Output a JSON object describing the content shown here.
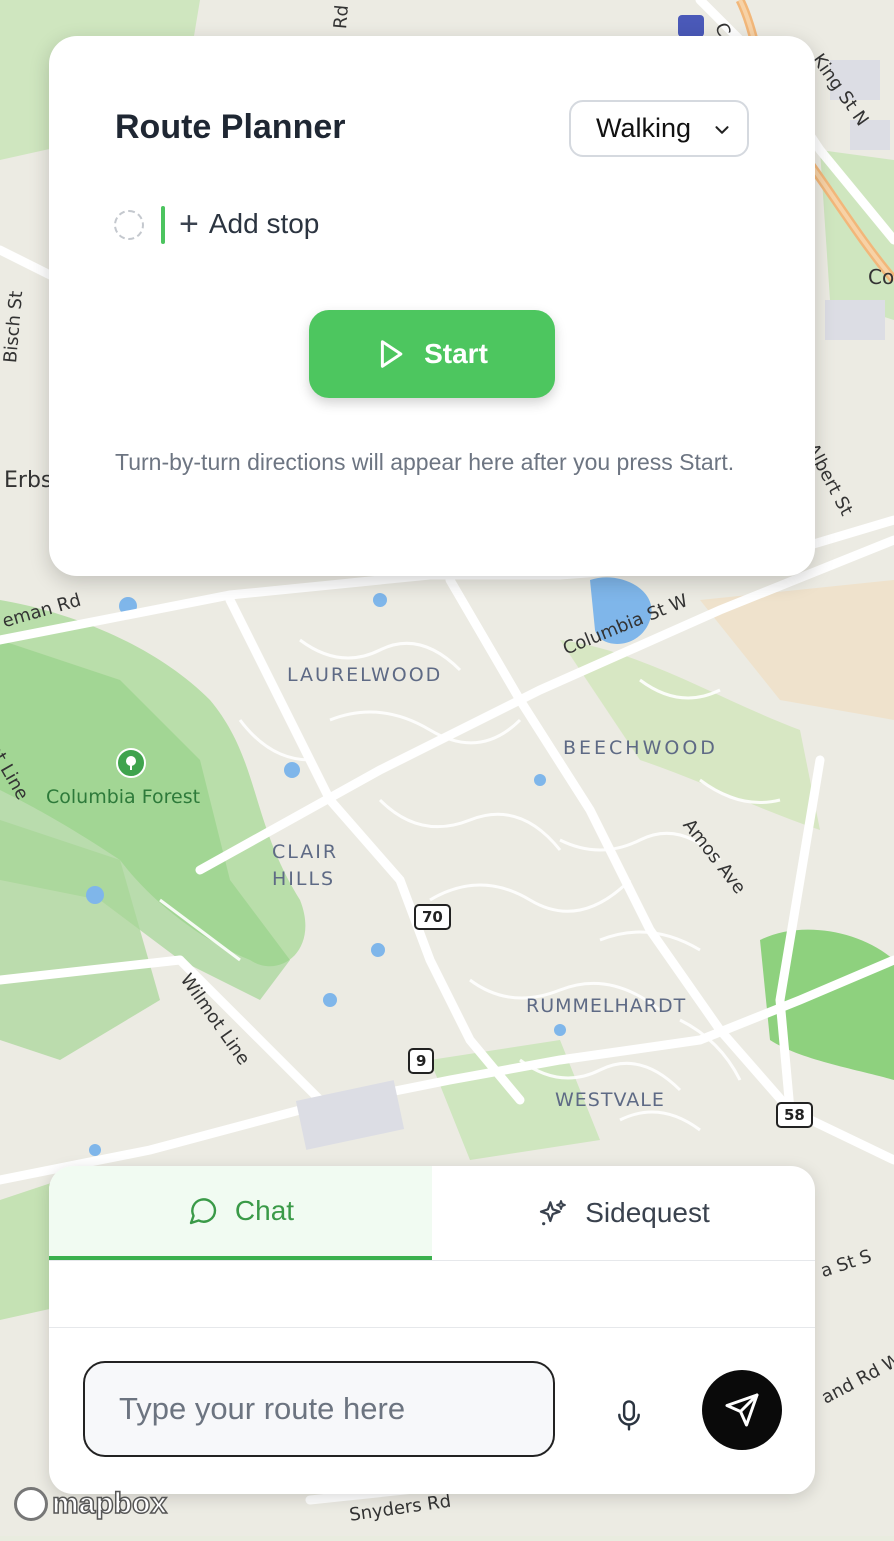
{
  "planner": {
    "title": "Route Planner",
    "mode": "Walking",
    "add_stop": "Add stop",
    "start": "Start",
    "hint": "Turn-by-turn directions will appear here after you press Start."
  },
  "chat": {
    "tab_chat": "Chat",
    "tab_sidequest": "Sidequest",
    "input_placeholder": "Type your route here"
  },
  "map": {
    "neighbourhoods": [
      "LAURELWOOD",
      "BEECHWOOD",
      "CLAIR",
      "HILLS",
      "RUMMELHARDT",
      "WESTVALE"
    ],
    "park": "Columbia Forest",
    "roads": [
      "Columbia St W",
      "Albert St",
      "King St N",
      "Amos Ave",
      "Wilmot Line",
      "Bisch St",
      "Erbs",
      "eman Rd",
      "Snyders Rd",
      "a St S",
      "and Rd W",
      "Rd",
      "Co",
      "ot Line",
      "C"
    ],
    "highways": [
      "70",
      "9",
      "58"
    ],
    "attribution": "mapbox"
  },
  "colors": {
    "accent": "#4dc65f",
    "park_green": "#a9d89a",
    "water": "#7fb6ea",
    "send_button": "#0a0a0a"
  },
  "icons": {
    "chevron": "chevron-down-icon",
    "play": "play-icon",
    "chat": "chat-bubble-icon",
    "sidequest": "sparkles-icon",
    "mic": "microphone-icon",
    "send": "send-icon"
  }
}
